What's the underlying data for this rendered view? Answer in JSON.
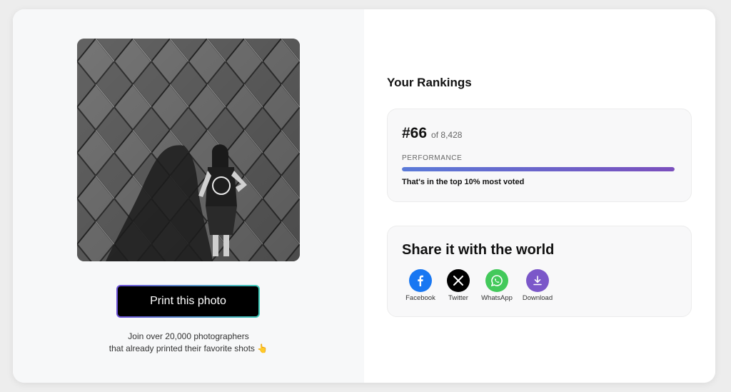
{
  "print": {
    "button_label": "Print this photo",
    "join_line1": "Join over 20,000 photographers",
    "join_line2": "that already printed their favorite shots 👆"
  },
  "rankings": {
    "title": "Your Rankings",
    "rank": "#66",
    "of_total": "of 8,428",
    "performance_label": "PERFORMANCE",
    "performance_fraction": 1.0,
    "summary": "That's in the top 10% most voted"
  },
  "share": {
    "title": "Share it with the world",
    "items": [
      {
        "label": "Facebook",
        "icon": "facebook-icon",
        "color": "#1877f2"
      },
      {
        "label": "Twitter",
        "icon": "x-icon",
        "color": "#000000"
      },
      {
        "label": "WhatsApp",
        "icon": "whatsapp-icon",
        "color": "#43c95b"
      },
      {
        "label": "Download",
        "icon": "download-icon",
        "color": "#7b57c9"
      }
    ]
  },
  "colors": {
    "accent_gradient_start": "#5a7ad8",
    "accent_gradient_end": "#7b4fbd",
    "button_border_start": "#6b4fd8",
    "button_border_end": "#3ec9b8"
  }
}
